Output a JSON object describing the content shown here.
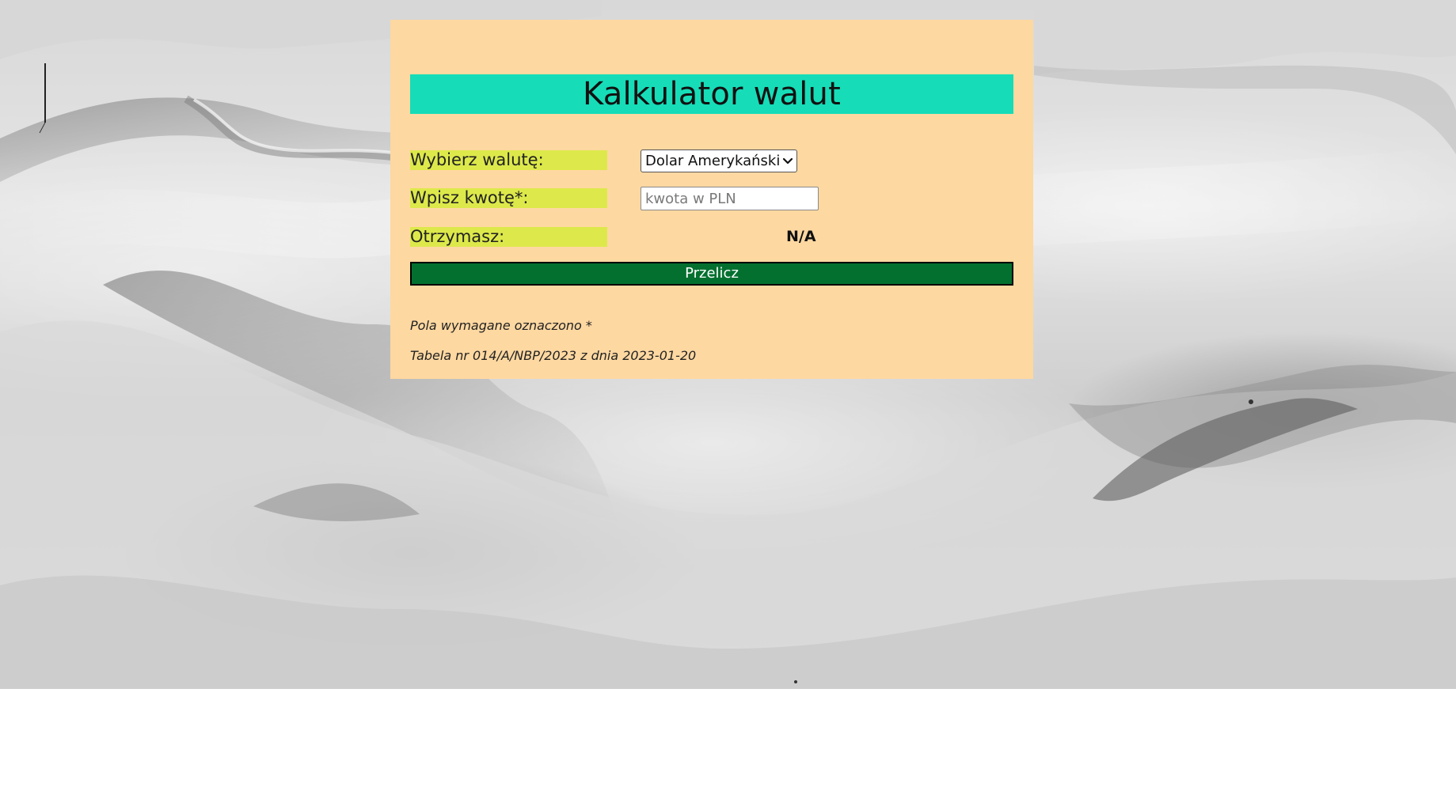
{
  "page": {
    "background_description_icon": "snowy-mountain-background-image"
  },
  "calculator": {
    "title": "Kalkulator walut",
    "currency_label": "Wybierz walutę:",
    "currency_selected": "Dolar Amerykański",
    "amount_label": "Wpisz kwotę*:",
    "amount_value": "",
    "amount_placeholder": "kwota w PLN",
    "result_label": "Otrzymasz:",
    "result_value": "N/A",
    "calculate_label": "Przelicz",
    "required_note": "Pola wymagane oznaczono *",
    "table_note": "Tabela nr 014/A/NBP/2023 z dnia 2023-01-20"
  },
  "colors": {
    "card_background": "#fed8a1",
    "title_background": "#16ddb8",
    "label_background": "#dde94a",
    "button_background": "#047030",
    "button_border": "#000000"
  }
}
